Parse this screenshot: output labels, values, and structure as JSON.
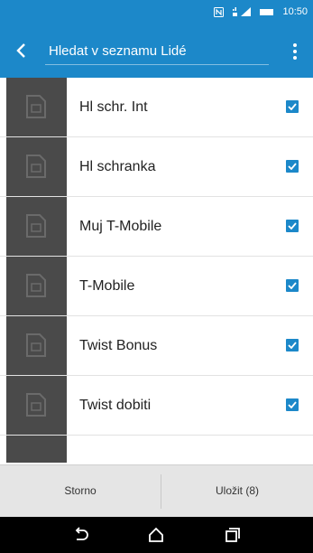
{
  "status_bar": {
    "time": "10:50",
    "icons": [
      "nfc-icon",
      "network-signal-icon",
      "battery-icon"
    ]
  },
  "app_bar": {
    "search_placeholder": "Hledat v seznamu Lidé",
    "icons": [
      "back-arrow-icon",
      "overflow-menu-icon"
    ]
  },
  "contacts": [
    {
      "label": "Hl schr. Int",
      "checked": true
    },
    {
      "label": "Hl schranka",
      "checked": true
    },
    {
      "label": "Muj T-Mobile",
      "checked": true
    },
    {
      "label": "T-Mobile",
      "checked": true
    },
    {
      "label": "Twist Bonus",
      "checked": true
    },
    {
      "label": "Twist dobiti",
      "checked": true
    }
  ],
  "actions": {
    "cancel_label": "Storno",
    "save_label": "Uložit (8)"
  },
  "nav": {
    "icons": [
      "back-nav-icon",
      "home-nav-icon",
      "recents-nav-icon"
    ]
  },
  "colors": {
    "accent": "#1c88c9",
    "thumb": "#4a4a4a",
    "action_bar": "#e5e5e5"
  }
}
